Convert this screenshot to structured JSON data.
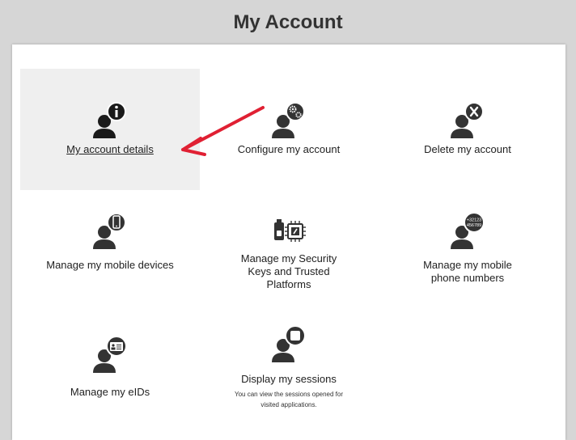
{
  "page": {
    "title": "My Account"
  },
  "tiles": [
    {
      "label": "My account details",
      "icon": "person-info-icon"
    },
    {
      "label": "Configure my account",
      "icon": "person-gears-icon"
    },
    {
      "label": "Delete my account",
      "icon": "person-x-icon"
    },
    {
      "label": "Manage my mobile devices",
      "icon": "person-mobile-icon"
    },
    {
      "label": "Manage my Security Keys and Trusted Platforms",
      "icon": "security-key-chip-icon"
    },
    {
      "label": "Manage my mobile phone numbers",
      "icon": "person-phone-number-icon",
      "icon_text": [
        "+32123",
        "456789"
      ]
    },
    {
      "label": "Manage my eIDs",
      "icon": "person-id-card-icon"
    },
    {
      "label": "Display my sessions",
      "icon": "person-session-icon",
      "description": "You can view the sessions opened for visited applications."
    }
  ],
  "colors": {
    "arrow": "#e02033",
    "active_tile": "#efefef",
    "icon": "#1a1a1a"
  }
}
